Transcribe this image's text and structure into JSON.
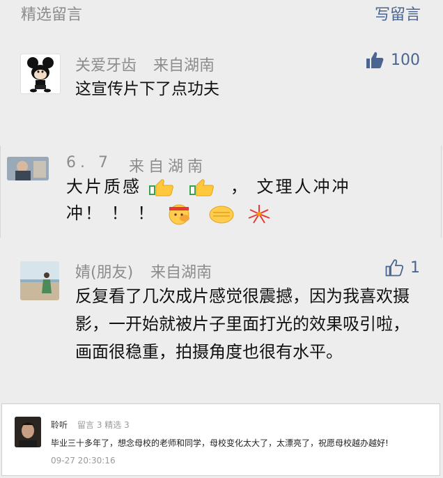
{
  "header": {
    "title": "精选留言",
    "write_label": "写留言"
  },
  "comments": [
    {
      "name": "关爱牙齿",
      "location": "来自湖南",
      "text": "这宣传片下了点功夫",
      "likes": "100"
    },
    {
      "name": "6. 7",
      "location": "来自湖南",
      "text_line1": "大片质感",
      "text_line1_tail": "，  文理人冲冲",
      "text_line2": "冲！ ！ ！"
    },
    {
      "name": "婧(朋友)",
      "location": "来自湖南",
      "text": "反复看了几次成片感觉很震撼，因为我喜欢摄影，一开始就被片子里面打光的效果吸引啦，画面很稳重，拍摄角度也很有水平。",
      "likes": "1"
    },
    {
      "name": "聆听",
      "meta": "留言 3   精选 3",
      "text": "毕业三十多年了，想念母校的老师和同学，母校变化太大了，太漂亮了，祝愿母校越办越好!",
      "time": "09-27 20:30:16"
    }
  ],
  "colors": {
    "accent": "#4a6591",
    "muted": "#8c8c8c",
    "bg": "#ededed"
  },
  "icons": [
    "thumbs-up-filled-icon",
    "thumbs-up-outline-icon",
    "thumbs-up-emoji",
    "flexed-fist-emoji",
    "cheering-face-emoji",
    "fireworks-emoji"
  ]
}
